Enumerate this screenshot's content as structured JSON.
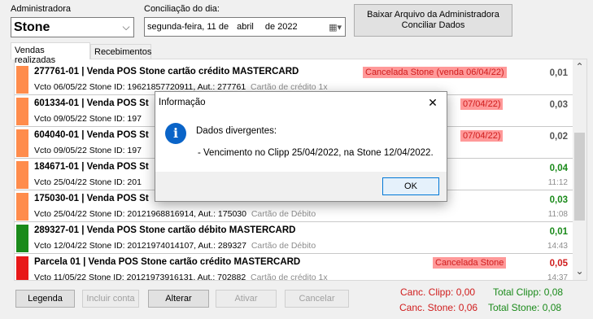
{
  "header": {
    "administradora_label": "Administradora",
    "administradora_value": "Stone",
    "conciliacao_label": "Conciliação do dia:",
    "date": {
      "weekday": "segunda-feira, 11 de",
      "month": "abril",
      "de": "de",
      "year": "2022"
    },
    "download_button": "Baixar Arquivo da Administradora\nConciliar Dados"
  },
  "tabs": [
    "Vendas realizadas",
    "Recebimentos"
  ],
  "rows": [
    {
      "color": "#ff8c4c",
      "title": "277761-01 | Venda POS Stone cartão crédito MASTERCARD",
      "sub": "Vcto 06/05/22   Stone ID: 19621857720911, Aut.: 277761",
      "sub_gray": "Cartão de crédito   1x",
      "status": "Cancelada Stone (venda 06/04/22)",
      "amount": "0,01",
      "amount_color": "#555555",
      "time": ""
    },
    {
      "color": "#ff8c4c",
      "title": "601334-01 | Venda POS St",
      "sub": "Vcto 09/05/22   Stone ID: 197",
      "sub_gray": "",
      "status": "07/04/22)",
      "amount": "0,03",
      "amount_color": "#555555",
      "time": ""
    },
    {
      "color": "#ff8c4c",
      "title": "604040-01 | Venda POS St",
      "sub": "Vcto 09/05/22   Stone ID: 197",
      "sub_gray": "",
      "status": "07/04/22)",
      "amount": "0,02",
      "amount_color": "#555555",
      "time": ""
    },
    {
      "color": "#ff8c4c",
      "title": "184671-01 | Venda POS St",
      "sub": "Vcto 25/04/22   Stone ID: 201",
      "sub_gray": "",
      "status": "",
      "amount": "0,04",
      "amount_color": "#1a8a1a",
      "time": "11:12"
    },
    {
      "color": "#ff8c4c",
      "title": "175030-01 | Venda POS St",
      "sub": "Vcto 25/04/22   Stone ID: 20121968816914, Aut.: 175030",
      "sub_gray": "Cartão de Débito",
      "status": "",
      "amount": "0,03",
      "amount_color": "#1a8a1a",
      "time": "11:08"
    },
    {
      "color": "#1a8a1a",
      "title": "289327-01 | Venda POS Stone cartão débito MASTERCARD",
      "sub": "Vcto 12/04/22   Stone ID: 20121974014107, Aut.: 289327",
      "sub_gray": "Cartão de Débito",
      "status": "",
      "amount": "0,01",
      "amount_color": "#1a8a1a",
      "time": "14:43"
    },
    {
      "color": "#e81818",
      "title": "Parcela 01 | Venda POS Stone cartão crédito MASTERCARD",
      "sub": "Vcto 11/05/22   Stone ID: 20121973916131, Aut.: 702882",
      "sub_gray": "Cartão de crédito   1x",
      "status": "Cancelada Stone",
      "amount": "0,05",
      "amount_color": "#d01c1c",
      "time": "14:37"
    }
  ],
  "footer": {
    "buttons": [
      "Legenda",
      "Incluir conta",
      "Alterar",
      "Ativar",
      "Cancelar"
    ],
    "canc_clipp": "Canc. Clipp: 0,00",
    "total_clipp": "Total Clipp: 0,08",
    "canc_stone": "Canc. Stone: 0,06",
    "total_stone": "Total Stone: 0,08"
  },
  "dialog": {
    "title": "Informação",
    "heading": "Dados divergentes:",
    "message": "- Vencimento no Clipp 25/04/2022, na Stone 12/04/2022.",
    "ok": "OK",
    "icon_glyph": "i",
    "close_glyph": "✕"
  },
  "glyphs": {
    "chevron_down": "⌵",
    "scroll_up": "⌃",
    "scroll_down": "⌄",
    "calendar": "▦▾"
  },
  "colors": {
    "orange": "#ff8c4c",
    "green": "#1a8a1a",
    "red": "#e81818",
    "info_blue": "#0a64c8"
  }
}
